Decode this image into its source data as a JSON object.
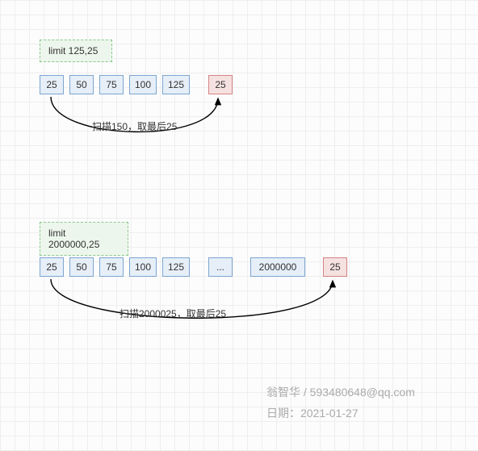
{
  "diagram1": {
    "limit_label": "limit 125,25",
    "scan_boxes": [
      "25",
      "50",
      "75",
      "100",
      "125"
    ],
    "result_box": "25",
    "caption": "扫描150，取最后25"
  },
  "diagram2": {
    "limit_label": "limit 2000000,25",
    "scan_boxes": [
      "25",
      "50",
      "75",
      "100",
      "125",
      "...",
      "2000000"
    ],
    "result_box": "25",
    "caption": "扫描2000025，取最后25"
  },
  "credit": {
    "author_line": "翁智华 / 593480648@qq.com",
    "date_line": "日期：2021-01-27"
  },
  "chart_data": [
    {
      "type": "table",
      "title": "limit 125,25",
      "scanned_values": [
        25,
        50,
        75,
        100,
        125
      ],
      "result_value": 25,
      "annotation": "扫描150，取最后25",
      "scan_total": 150,
      "take_last": 25
    },
    {
      "type": "table",
      "title": "limit 2000000,25",
      "scanned_values": [
        25,
        50,
        75,
        100,
        125,
        "...",
        2000000
      ],
      "result_value": 25,
      "annotation": "扫描2000025，取最后25",
      "scan_total": 2000025,
      "take_last": 25
    }
  ]
}
